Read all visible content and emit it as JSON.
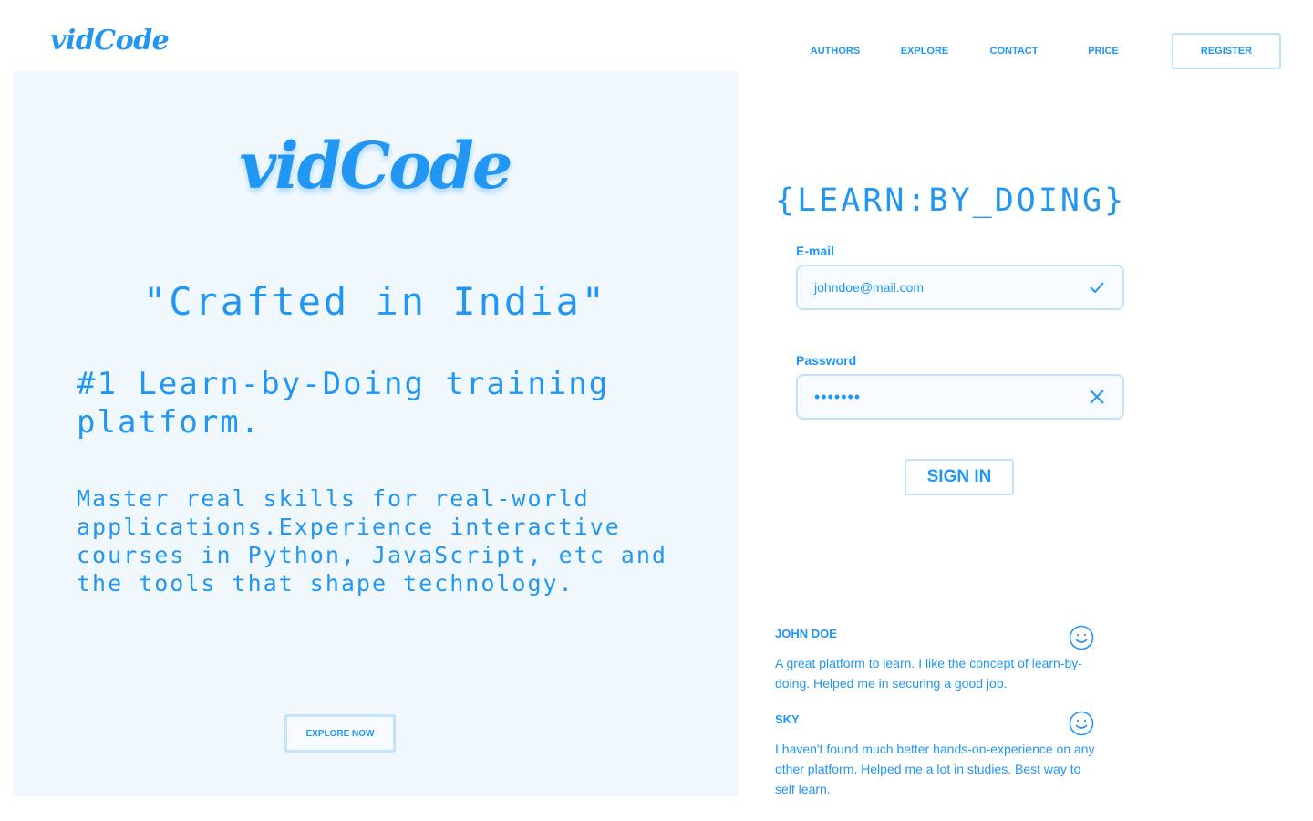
{
  "brand": {
    "logo": "vidCode"
  },
  "nav": {
    "items": [
      {
        "label": "AUTHORS"
      },
      {
        "label": "EXPLORE"
      },
      {
        "label": "CONTACT"
      },
      {
        "label": "PRICE"
      }
    ],
    "register_label": "REGISTER"
  },
  "hero": {
    "logo": "vidCode",
    "tagline": "\"Crafted in India\"",
    "headline": "#1 Learn-by-Doing training platform.",
    "description": "Master real skills for real-world applications.Experience interactive courses in Python, JavaScript, etc and the tools that shape technology.",
    "explore_label": "EXPLORE NOW"
  },
  "login": {
    "title": "{LEARN:BY_DOING}",
    "email_label": "E-mail",
    "email_value": "johndoe@mail.com",
    "email_status_icon": "check-icon",
    "password_label": "Password",
    "password_value": "•••••••",
    "password_status_icon": "close-icon",
    "signin_label": "SIGN IN"
  },
  "reviews": [
    {
      "name": "JOHN DOE",
      "text": "A great platform to learn. I like the concept of learn-by-doing. Helped me in securing a good job.",
      "icon": "smiley-icon"
    },
    {
      "name": "SKY",
      "text": "I haven't found much better hands-on-experience on any other platform. Helped me a lot in studies. Best way to self learn.",
      "icon": "smiley-icon"
    }
  ],
  "colors": {
    "accent": "#2196f3",
    "panel_bg": "#f0f8fe",
    "border": "#c2e1fb"
  }
}
